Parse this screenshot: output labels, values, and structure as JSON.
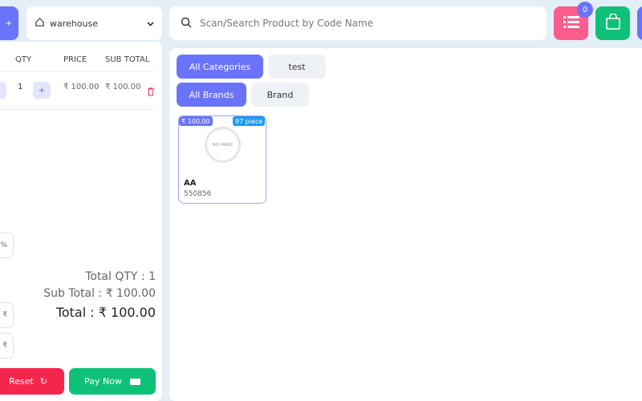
{
  "header": {
    "warehouse": "warehouse",
    "search_placeholder": "Scan/Search Product by Code Name",
    "list_badge": "0"
  },
  "cart": {
    "columns": [
      "QTY",
      "PRICE",
      "SUB TOTAL"
    ],
    "items": [
      {
        "qty": "1",
        "price": "₹ 100.00",
        "subtotal": "₹ 100.00"
      }
    ],
    "discount_unit": "%",
    "tax_unit": "₹",
    "shipping_unit": "₹",
    "total_qty": "Total QTY : 1",
    "sub_total": "Sub Total : ₹ 100.00",
    "total": "Total : ₹ 100.00",
    "reset_label": "Reset",
    "pay_label": "Pay Now"
  },
  "filters": {
    "categories": [
      {
        "label": "All Categories",
        "active": true
      },
      {
        "label": "test",
        "active": false
      }
    ],
    "brands": [
      {
        "label": "All Brands",
        "active": true
      },
      {
        "label": "Brand",
        "active": false
      }
    ]
  },
  "products": [
    {
      "name": "AA",
      "code": "550856",
      "price": "₹ 100.00",
      "stock": "97 piece",
      "image_text": "NO IMAGE"
    }
  ],
  "colors": {
    "primary": "#6a74fb",
    "danger": "#f5264d",
    "success": "#0fc178",
    "pink": "#fb5d8c"
  }
}
